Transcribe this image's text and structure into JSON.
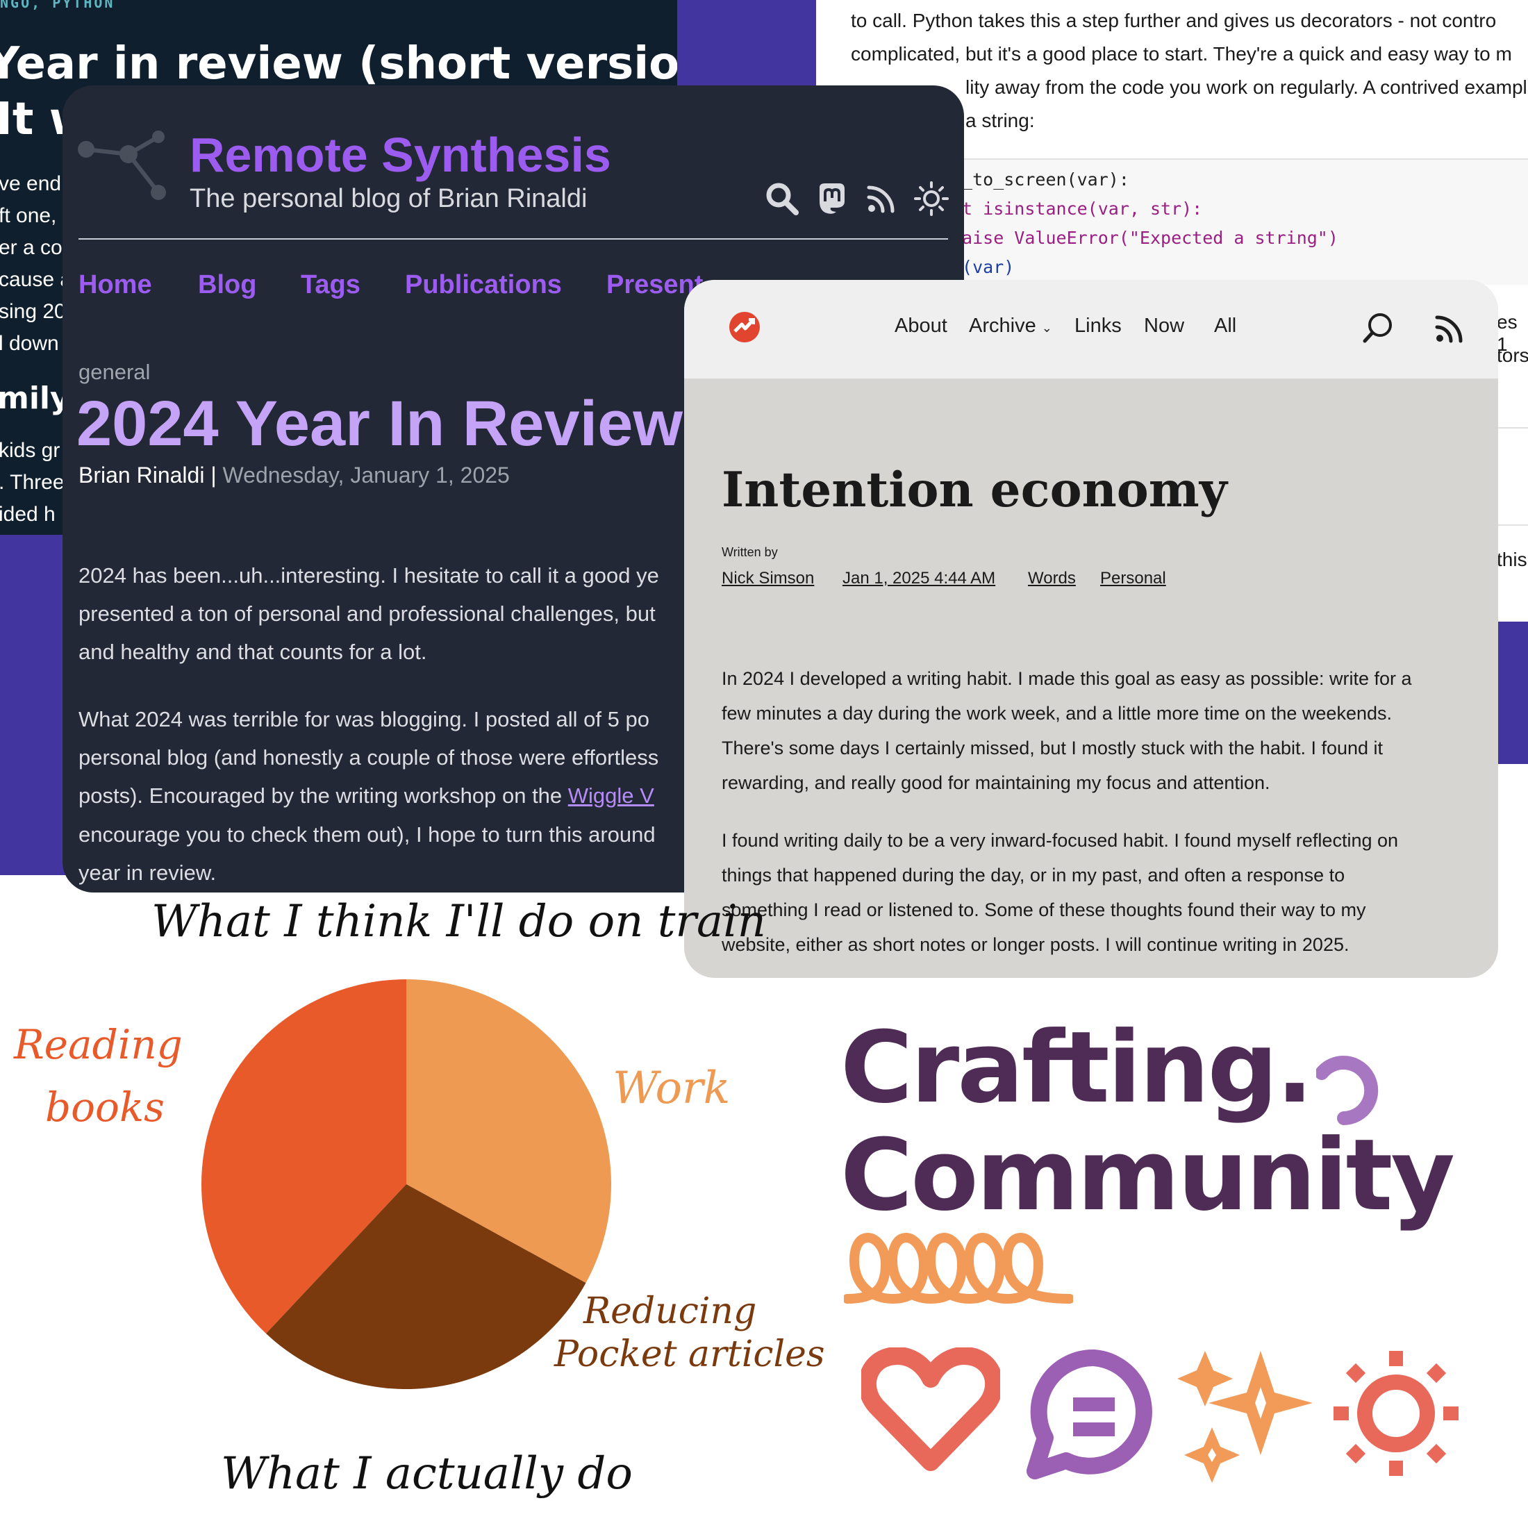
{
  "background_dark_blog": {
    "tag": "NGO, PYTHON",
    "title": "Year in review (short version)",
    "subtitle_fragment": "It w",
    "text_fragments": [
      "ve end",
      "ft one,",
      "er a co",
      "cause a",
      "sing 20",
      "l down"
    ],
    "heading_fragment": "mily",
    "text_fragments2": [
      "kids gr",
      ". Three",
      "ided h"
    ]
  },
  "background_python_article": {
    "lines": [
      "to call. Python takes this a step further and gives us decorators - not contro",
      "complicated, but it's a good place to start. They're a quick and easy way to m",
      "lity away from the code you work on regularly. A contrived exampl",
      "a string:"
    ],
    "code": {
      "line1": "e_to_screen(var):",
      "line2": "ot isinstance(var, str):",
      "line3": "raise ValueError(\"Expected a string\")",
      "line4": "t(var)"
    },
    "frag_right_1": "es 1",
    "frag_right_2": "tors",
    "frag_right_3": "this"
  },
  "remote_synthesis": {
    "site_title": "Remote Synthesis",
    "tagline": "The personal blog of Brian Rinaldi",
    "icons": [
      "search-icon",
      "mastodon-icon",
      "rss-icon",
      "theme-toggle-icon"
    ],
    "nav": [
      "Home",
      "Blog",
      "Tags",
      "Publications",
      "Present"
    ],
    "category": "general",
    "post_title": "2024 Year In Review",
    "author": "Brian Rinaldi",
    "date": "Wednesday, January 1, 2025",
    "para1": [
      "2024 has been...uh...interesting. I hesitate to call it a good ye",
      "presented a ton of personal and professional challenges, but",
      "and healthy and that counts for a lot."
    ],
    "para2": [
      "What 2024 was terrible for was blogging. I posted all of 5 po",
      "personal blog (and honestly a couple of those were effortless",
      "posts). Encouraged by the writing workshop on the ",
      "encourage you to check them out), I hope to turn this around",
      "year in review."
    ],
    "link_text": "Wiggle V"
  },
  "intention_economy": {
    "nav": [
      "About",
      "Archive",
      "Links",
      "Now",
      "All"
    ],
    "title": "Intention economy",
    "written_by": "Written by",
    "author": "Nick Simson",
    "datetime": "Jan 1, 2025 4:44 AM",
    "category": "Words",
    "tag": "Personal",
    "para1": [
      "In 2024 I developed a writing habit. I made this goal as easy as possible: write for a",
      "few minutes a day during the work week, and a little more time on the weekends.",
      "There's some days I certainly missed, but I mostly stuck with the habit. I found it",
      "rewarding, and really good for maintaining my focus and attention."
    ],
    "para2": [
      "I found writing daily to be a very inward-focused habit. I found myself reflecting on",
      "things that happened during the day, or in my past, and often a response to",
      "something I read or listened to. Some of these thoughts found their way to my",
      "website, either as short notes or longer posts. I will continue writing in 2025."
    ]
  },
  "handwritten_pie": {
    "top_caption": "What I think I'll do on train",
    "bottom_caption": "What I actually do",
    "reading_1": "Reading",
    "reading_2": "books",
    "work": "Work",
    "reducing_1": "Reducing",
    "reducing_2": "Pocket articles",
    "colors": {
      "reading": "#e85a29",
      "work": "#ee9a52",
      "reducing": "#7a3a0e"
    }
  },
  "chart_data": {
    "type": "pie",
    "title": "",
    "categories": [
      "Reading books",
      "Work",
      "Reducing Pocket articles"
    ],
    "values": [
      38,
      33,
      29
    ]
  },
  "crafting_community": {
    "line1": "Crafting.",
    "line2": "Community",
    "icons": [
      "heart-icon",
      "chat-bubble-icon",
      "sparkles-icon",
      "sun-icon"
    ],
    "colors": {
      "text": "#4f2c56",
      "heart": "#e8685a",
      "chat": "#9b5fb4",
      "sparkle": "#f29a58",
      "sun": "#e8685a"
    }
  }
}
